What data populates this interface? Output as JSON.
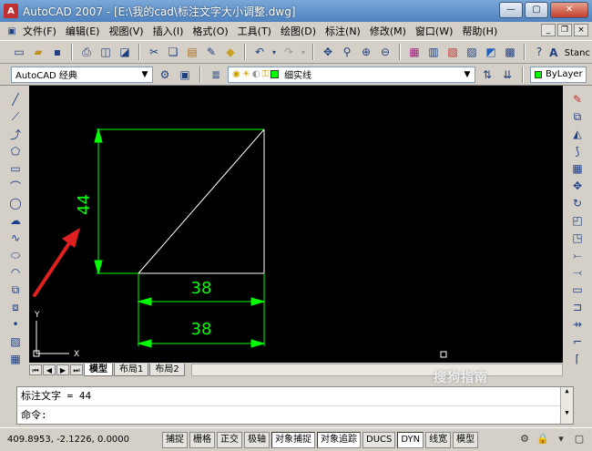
{
  "window": {
    "title": "AutoCAD 2007 - [E:\\我的cad\\标注文字大小调整.dwg]",
    "app_icon": "A"
  },
  "menu": [
    "文件(F)",
    "编辑(E)",
    "视图(V)",
    "插入(I)",
    "格式(O)",
    "工具(T)",
    "绘图(D)",
    "标注(N)",
    "修改(M)",
    "窗口(W)",
    "帮助(H)"
  ],
  "toolbar": {
    "style_label": "Stanc"
  },
  "workspace": {
    "value": "AutoCAD 经典"
  },
  "layer": {
    "value": "细实线",
    "color": "#00ff00"
  },
  "color_combo": {
    "value": "ByLayer"
  },
  "drawing": {
    "dim_vertical": "44",
    "dim_horizontal_1": "38",
    "dim_horizontal_2": "38",
    "ucs_y": "Y",
    "ucs_x": "X",
    "line_color": "#ffffff",
    "dim_color": "#00ff00",
    "arrow_color": "#e02020"
  },
  "tabs": [
    "模型",
    "布局1",
    "布局2"
  ],
  "command": {
    "history": "标注文字 = 44",
    "prompt": "命令:"
  },
  "status": {
    "coords": "409.8953, -2.1226, 0.0000",
    "buttons": [
      "捕捉",
      "栅格",
      "正交",
      "极轴",
      "对象捕捉",
      "对象追踪",
      "DUCS",
      "DYN",
      "线宽",
      "模型"
    ]
  },
  "watermark": "搜狗指南"
}
